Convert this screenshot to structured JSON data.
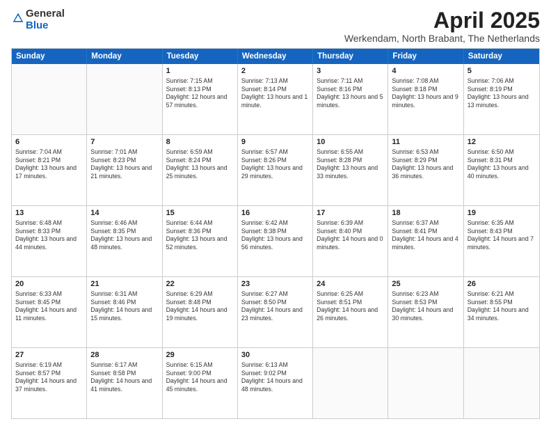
{
  "logo": {
    "general": "General",
    "blue": "Blue"
  },
  "title": {
    "month": "April 2025",
    "location": "Werkendam, North Brabant, The Netherlands"
  },
  "weekdays": [
    "Sunday",
    "Monday",
    "Tuesday",
    "Wednesday",
    "Thursday",
    "Friday",
    "Saturday"
  ],
  "weeks": [
    [
      {
        "day": "",
        "info": ""
      },
      {
        "day": "",
        "info": ""
      },
      {
        "day": "1",
        "info": "Sunrise: 7:15 AM\nSunset: 8:13 PM\nDaylight: 12 hours and 57 minutes."
      },
      {
        "day": "2",
        "info": "Sunrise: 7:13 AM\nSunset: 8:14 PM\nDaylight: 13 hours and 1 minute."
      },
      {
        "day": "3",
        "info": "Sunrise: 7:11 AM\nSunset: 8:16 PM\nDaylight: 13 hours and 5 minutes."
      },
      {
        "day": "4",
        "info": "Sunrise: 7:08 AM\nSunset: 8:18 PM\nDaylight: 13 hours and 9 minutes."
      },
      {
        "day": "5",
        "info": "Sunrise: 7:06 AM\nSunset: 8:19 PM\nDaylight: 13 hours and 13 minutes."
      }
    ],
    [
      {
        "day": "6",
        "info": "Sunrise: 7:04 AM\nSunset: 8:21 PM\nDaylight: 13 hours and 17 minutes."
      },
      {
        "day": "7",
        "info": "Sunrise: 7:01 AM\nSunset: 8:23 PM\nDaylight: 13 hours and 21 minutes."
      },
      {
        "day": "8",
        "info": "Sunrise: 6:59 AM\nSunset: 8:24 PM\nDaylight: 13 hours and 25 minutes."
      },
      {
        "day": "9",
        "info": "Sunrise: 6:57 AM\nSunset: 8:26 PM\nDaylight: 13 hours and 29 minutes."
      },
      {
        "day": "10",
        "info": "Sunrise: 6:55 AM\nSunset: 8:28 PM\nDaylight: 13 hours and 33 minutes."
      },
      {
        "day": "11",
        "info": "Sunrise: 6:53 AM\nSunset: 8:29 PM\nDaylight: 13 hours and 36 minutes."
      },
      {
        "day": "12",
        "info": "Sunrise: 6:50 AM\nSunset: 8:31 PM\nDaylight: 13 hours and 40 minutes."
      }
    ],
    [
      {
        "day": "13",
        "info": "Sunrise: 6:48 AM\nSunset: 8:33 PM\nDaylight: 13 hours and 44 minutes."
      },
      {
        "day": "14",
        "info": "Sunrise: 6:46 AM\nSunset: 8:35 PM\nDaylight: 13 hours and 48 minutes."
      },
      {
        "day": "15",
        "info": "Sunrise: 6:44 AM\nSunset: 8:36 PM\nDaylight: 13 hours and 52 minutes."
      },
      {
        "day": "16",
        "info": "Sunrise: 6:42 AM\nSunset: 8:38 PM\nDaylight: 13 hours and 56 minutes."
      },
      {
        "day": "17",
        "info": "Sunrise: 6:39 AM\nSunset: 8:40 PM\nDaylight: 14 hours and 0 minutes."
      },
      {
        "day": "18",
        "info": "Sunrise: 6:37 AM\nSunset: 8:41 PM\nDaylight: 14 hours and 4 minutes."
      },
      {
        "day": "19",
        "info": "Sunrise: 6:35 AM\nSunset: 8:43 PM\nDaylight: 14 hours and 7 minutes."
      }
    ],
    [
      {
        "day": "20",
        "info": "Sunrise: 6:33 AM\nSunset: 8:45 PM\nDaylight: 14 hours and 11 minutes."
      },
      {
        "day": "21",
        "info": "Sunrise: 6:31 AM\nSunset: 8:46 PM\nDaylight: 14 hours and 15 minutes."
      },
      {
        "day": "22",
        "info": "Sunrise: 6:29 AM\nSunset: 8:48 PM\nDaylight: 14 hours and 19 minutes."
      },
      {
        "day": "23",
        "info": "Sunrise: 6:27 AM\nSunset: 8:50 PM\nDaylight: 14 hours and 23 minutes."
      },
      {
        "day": "24",
        "info": "Sunrise: 6:25 AM\nSunset: 8:51 PM\nDaylight: 14 hours and 26 minutes."
      },
      {
        "day": "25",
        "info": "Sunrise: 6:23 AM\nSunset: 8:53 PM\nDaylight: 14 hours and 30 minutes."
      },
      {
        "day": "26",
        "info": "Sunrise: 6:21 AM\nSunset: 8:55 PM\nDaylight: 14 hours and 34 minutes."
      }
    ],
    [
      {
        "day": "27",
        "info": "Sunrise: 6:19 AM\nSunset: 8:57 PM\nDaylight: 14 hours and 37 minutes."
      },
      {
        "day": "28",
        "info": "Sunrise: 6:17 AM\nSunset: 8:58 PM\nDaylight: 14 hours and 41 minutes."
      },
      {
        "day": "29",
        "info": "Sunrise: 6:15 AM\nSunset: 9:00 PM\nDaylight: 14 hours and 45 minutes."
      },
      {
        "day": "30",
        "info": "Sunrise: 6:13 AM\nSunset: 9:02 PM\nDaylight: 14 hours and 48 minutes."
      },
      {
        "day": "",
        "info": ""
      },
      {
        "day": "",
        "info": ""
      },
      {
        "day": "",
        "info": ""
      }
    ]
  ]
}
